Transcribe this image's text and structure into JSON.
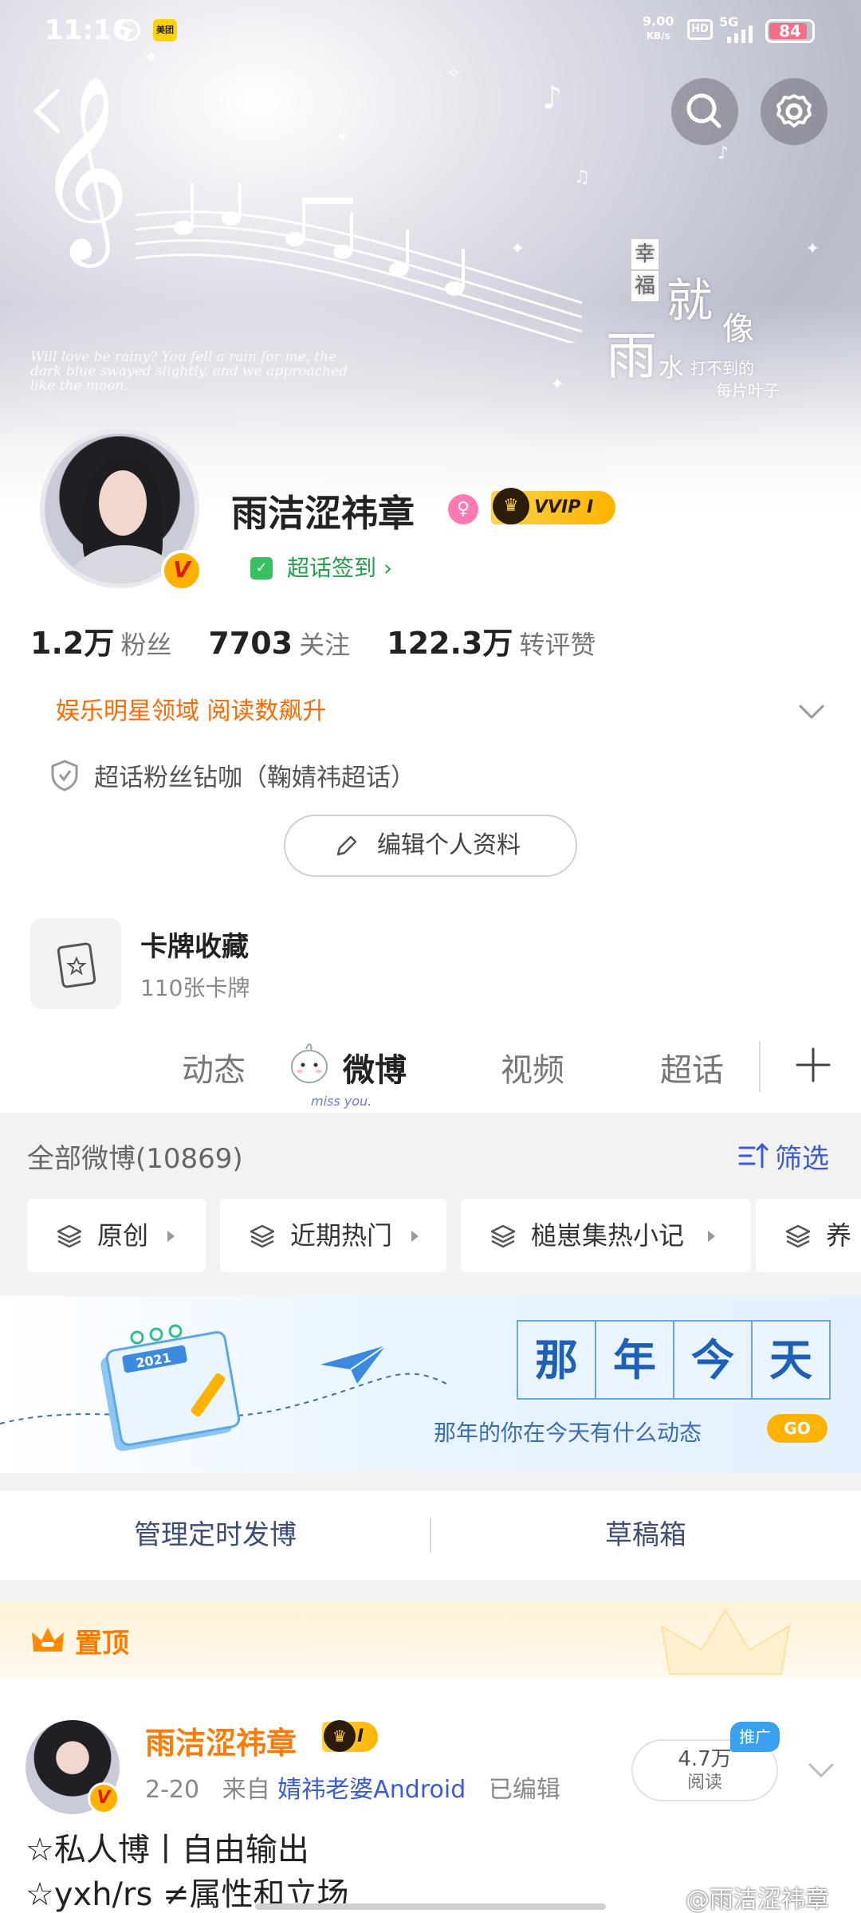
{
  "status_bar": {
    "time": "11:16",
    "meituan": "美团",
    "net_speed_value": "9.00",
    "net_speed_unit": "KB/s",
    "hd": "HD",
    "network": "5G",
    "battery": "84"
  },
  "banner": {
    "poem_en": "Will love be rainy? You fell a rain for me, the dark blue swayed slightly, and we approached like the moon.",
    "cn_char1": "幸",
    "cn_char2": "福",
    "cn_big1": "雨",
    "cn_big2": "就",
    "cn_big3": "像",
    "cn_small1": "水",
    "cn_small2": "打不到的",
    "cn_small3": "每片叶子"
  },
  "profile": {
    "name": "雨洁涩祎章",
    "gender_symbol": "♀",
    "vip_label": "VVIP Ⅰ",
    "verified_symbol": "V",
    "checkin_label": "超话签到 ›",
    "stats": [
      {
        "num": "1.2万",
        "label": "粉丝"
      },
      {
        "num": "7703",
        "label": "关注"
      },
      {
        "num": "122.3万",
        "label": "转评赞"
      }
    ],
    "tag": "娱乐明星领域 阅读数飙升",
    "fan_title": "超话粉丝钻咖（鞠婧祎超话）",
    "edit_button": "编辑个人资料"
  },
  "cards": {
    "title": "卡牌收藏",
    "sub": "110张卡牌"
  },
  "tabs": {
    "items": [
      "动态",
      "微博",
      "视频",
      "超话"
    ],
    "active": "微博",
    "mascot_caption": "miss you."
  },
  "feed": {
    "all_label": "全部微博(10869)",
    "filter_label": "筛选",
    "chips": [
      "原创",
      "近期热门",
      "槌崽集热小记",
      "养"
    ]
  },
  "promo": {
    "title_chars": [
      "那",
      "年",
      "今",
      "天"
    ],
    "subtitle": "那年的你在今天有什么动态",
    "go": "GO",
    "calendar_year": "2021"
  },
  "manage": {
    "left": "管理定时发博",
    "right": "草稿箱"
  },
  "post": {
    "pinned_label": "置顶",
    "author": "雨洁涩祎章",
    "level": "Ⅰ",
    "date": "2-20",
    "from": "来自",
    "source": "婧祎老婆Android",
    "edited": "已编辑",
    "reads_num": "4.7万",
    "reads_label": "阅读",
    "promo_tag": "推广",
    "line1": "☆私人博丨自由输出",
    "line2": "☆yxh/rs ≠属性和立场",
    "watermark": "@雨洁涩祎章"
  },
  "colors": {
    "accent_blue": "#3a5bd9",
    "orange": "#ff7a00",
    "green": "#21a04a",
    "gold": "#ffb300"
  }
}
